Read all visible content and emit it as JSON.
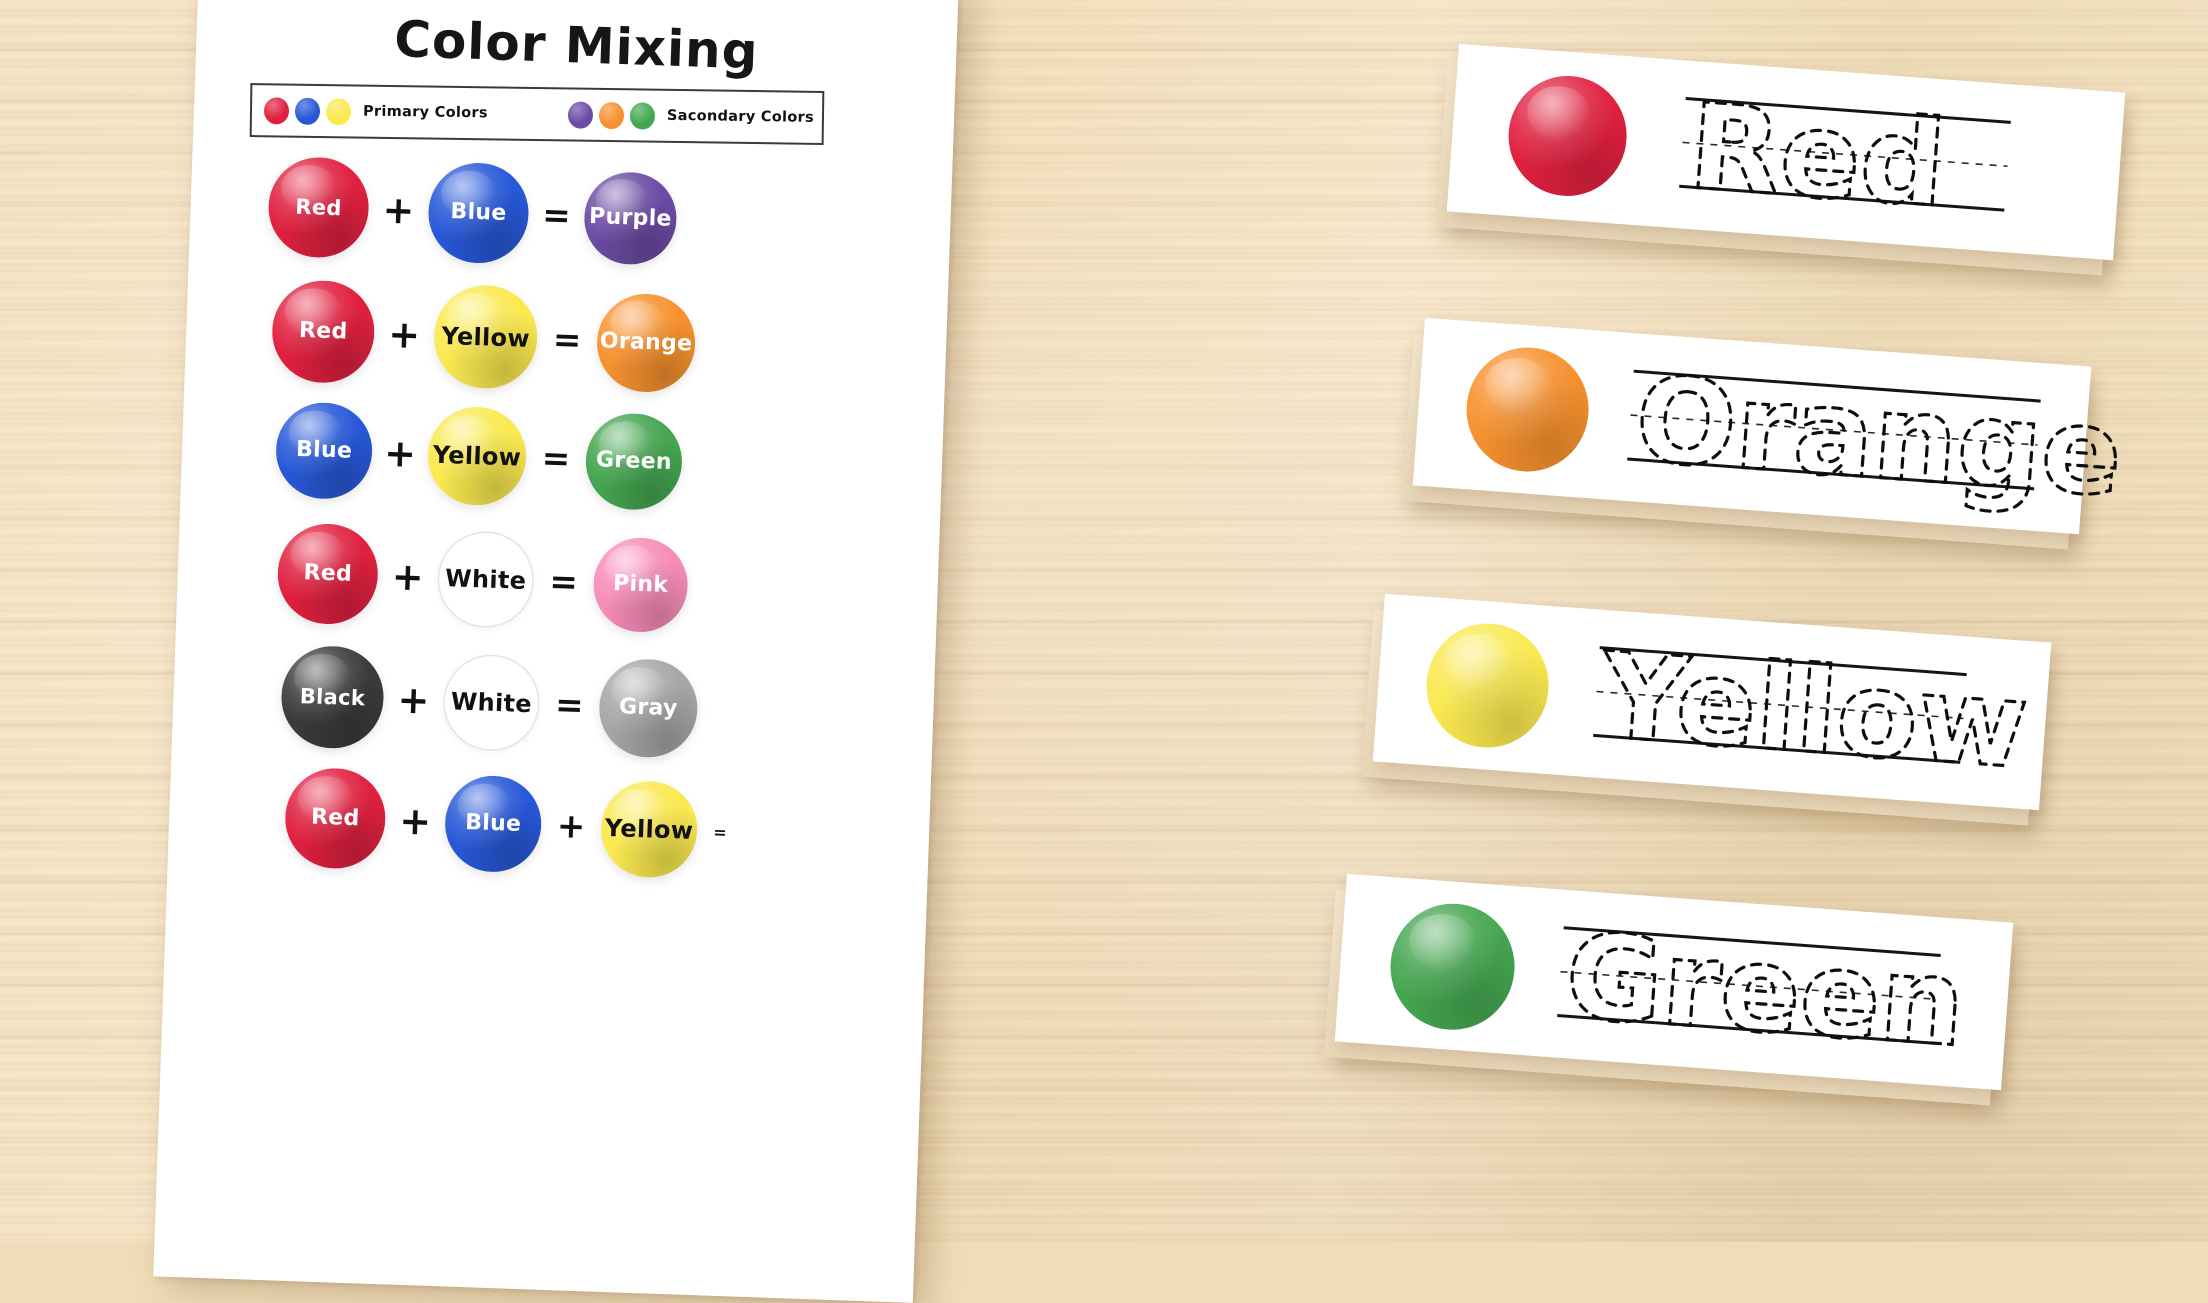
{
  "scene": {
    "surface": "wooden-table",
    "surface_color": "#f2e0be"
  },
  "worksheet": {
    "title": "Color Mixing",
    "legend": {
      "primary": {
        "label": "Primary Colors",
        "swatches": [
          "#e0203f",
          "#2758d8",
          "#fae94f"
        ]
      },
      "secondary": {
        "label": "Sacondary Colors",
        "swatches": [
          "#6b4ba3",
          "#f7912e",
          "#45a651"
        ]
      }
    },
    "rows": [
      {
        "a": {
          "label": "Red",
          "color": "#e0203f",
          "text_color": "#ffffff"
        },
        "op1": "+",
        "b": {
          "label": "Blue",
          "color": "#2758d8",
          "text_color": "#ffffff"
        },
        "op2": "=",
        "c": {
          "label": "Purple",
          "color": "#6b4ba3",
          "text_color": "#ffffff"
        }
      },
      {
        "a": {
          "label": "Red",
          "color": "#e0203f",
          "text_color": "#ffffff"
        },
        "op1": "+",
        "b": {
          "label": "Yellow",
          "color": "#fae94f",
          "text_color": "#111111"
        },
        "op2": "=",
        "c": {
          "label": "Orange",
          "color": "#f7912e",
          "text_color": "#ffffff"
        }
      },
      {
        "a": {
          "label": "Blue",
          "color": "#2758d8",
          "text_color": "#ffffff"
        },
        "op1": "+",
        "b": {
          "label": "Yellow",
          "color": "#fae94f",
          "text_color": "#111111"
        },
        "op2": "=",
        "c": {
          "label": "Green",
          "color": "#45a651",
          "text_color": "#ffffff"
        }
      },
      {
        "a": {
          "label": "Red",
          "color": "#e0203f",
          "text_color": "#ffffff"
        },
        "op1": "+",
        "b": {
          "label": "White",
          "color": "#ffffff",
          "text_color": "#111111"
        },
        "op2": "=",
        "c": {
          "label": "Pink",
          "color": "#f78cb8",
          "text_color": "#ffffff"
        }
      },
      {
        "a": {
          "label": "Black",
          "color": "#3b3b3b",
          "text_color": "#ffffff"
        },
        "op1": "+",
        "b": {
          "label": "White",
          "color": "#ffffff",
          "text_color": "#111111"
        },
        "op2": "=",
        "c": {
          "label": "Gray",
          "color": "#a6a6a6",
          "text_color": "#ffffff"
        }
      },
      {
        "a": {
          "label": "Red",
          "color": "#e0203f",
          "text_color": "#ffffff"
        },
        "op1": "+",
        "b": {
          "label": "Blue",
          "color": "#2758d8",
          "text_color": "#ffffff"
        },
        "op2": "+",
        "c": {
          "label": "Yellow",
          "color": "#fae94f",
          "text_color": "#111111"
        },
        "op3": "=",
        "result_cut_off": true
      }
    ]
  },
  "flashcards": [
    {
      "word": "Red",
      "color": "#e0203f"
    },
    {
      "word": "Orange",
      "color": "#f7912e"
    },
    {
      "word": "Yellow",
      "color": "#fae94f"
    },
    {
      "word": "Green",
      "color": "#45a651"
    }
  ]
}
